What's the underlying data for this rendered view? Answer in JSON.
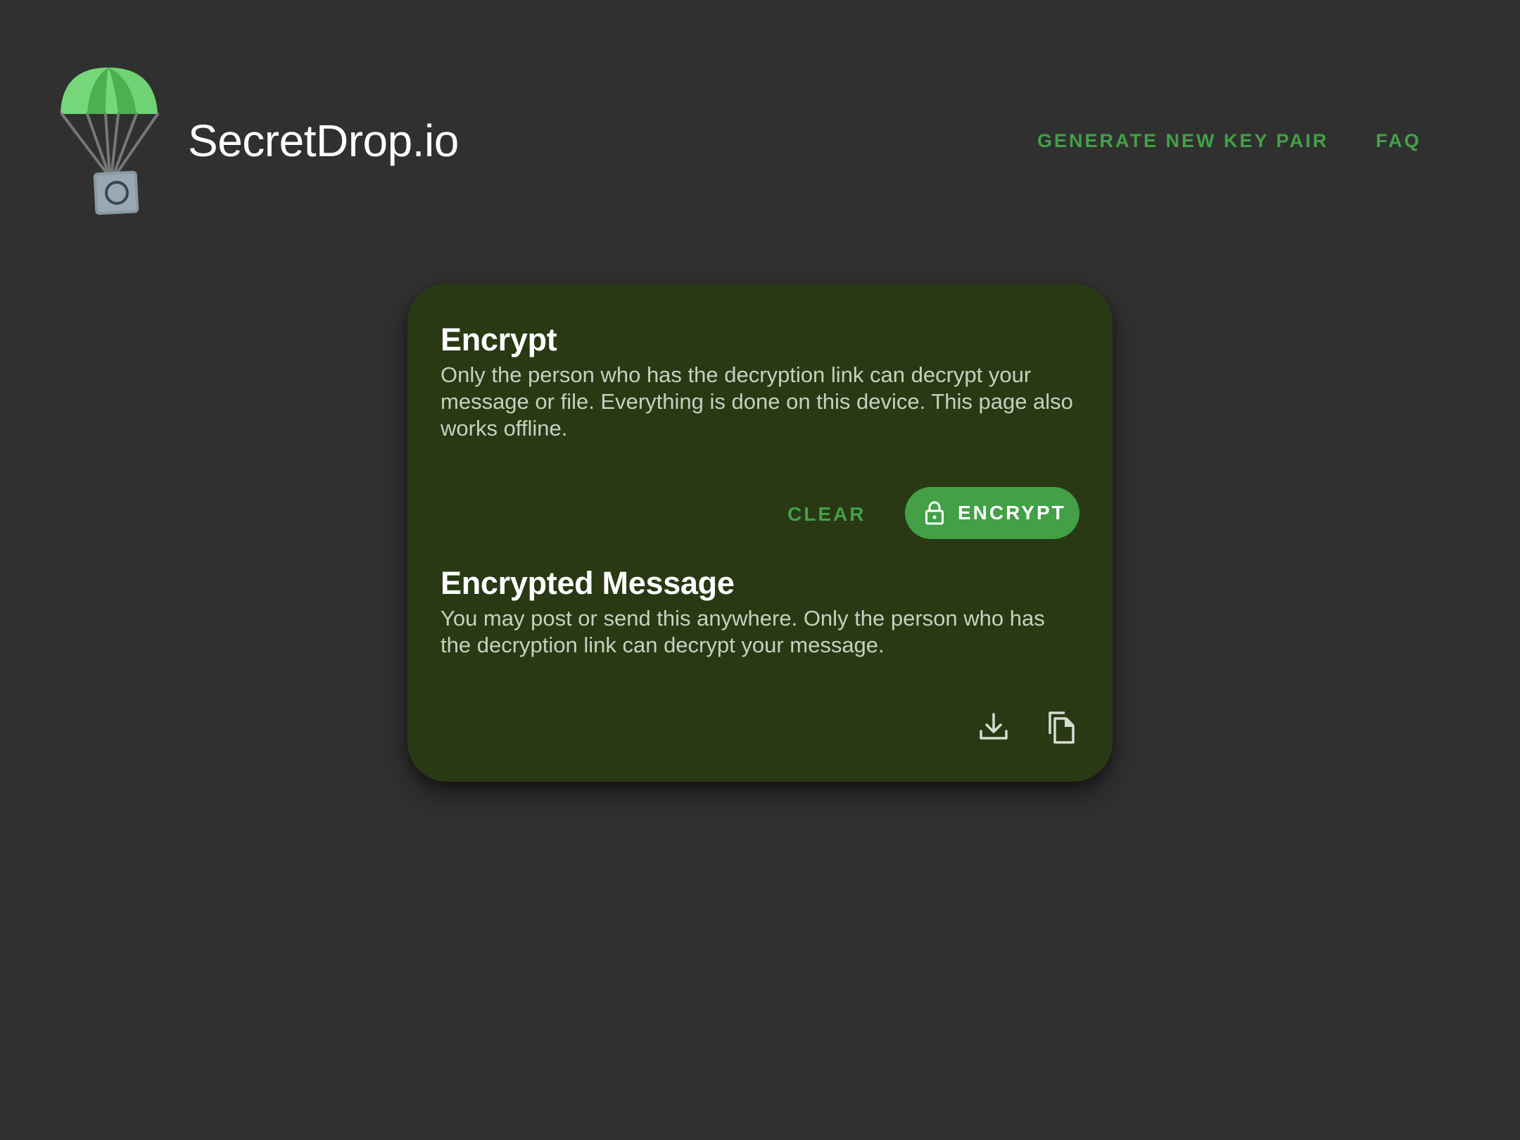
{
  "header": {
    "app_title": "SecretDrop.io",
    "logo_icon": "parachute-safe-icon",
    "nav": {
      "generate_label": "GENERATE NEW KEY PAIR",
      "faq_label": "FAQ"
    }
  },
  "card": {
    "encrypt": {
      "title": "Encrypt",
      "description": "Only the person who has the decryption link can decrypt your message or file. Everything is done on this device. This page also works offline."
    },
    "actions": {
      "clear_label": "CLEAR",
      "encrypt_label": "ENCRYPT",
      "encrypt_icon": "lock-icon"
    },
    "encrypted_message": {
      "title": "Encrypted Message",
      "description": "You may post or send this anywhere. Only the person who has the decryption link can decrypt your message."
    },
    "icons": {
      "download": "download-icon",
      "copy": "copy-icon"
    }
  },
  "colors": {
    "background": "#303030",
    "card": "#283914",
    "accent": "#43a047",
    "text_primary": "#ffffff",
    "text_secondary": "#c8d0c0"
  }
}
